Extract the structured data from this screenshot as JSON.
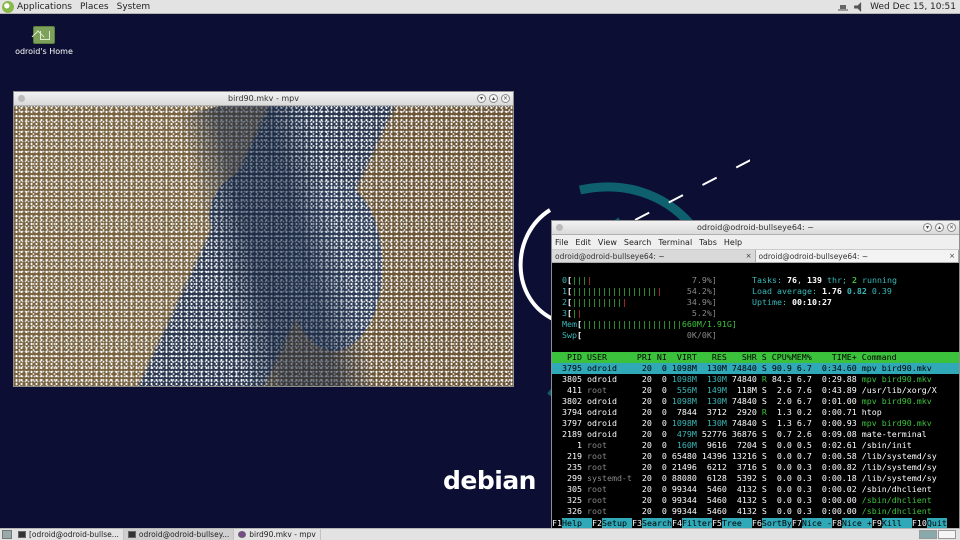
{
  "top_panel": {
    "menus": [
      "Applications",
      "Places",
      "System"
    ],
    "clock": "Wed Dec 15, 10:51"
  },
  "desktop": {
    "home_icon_label": "odroid's Home",
    "wallpaper_text": "debian"
  },
  "mpv_window": {
    "title": "bird90.mkv - mpv"
  },
  "terminal_window": {
    "title": "odroid@odroid-bullseye64: ~",
    "menus": [
      "File",
      "Edit",
      "View",
      "Search",
      "Terminal",
      "Tabs",
      "Help"
    ],
    "tabs": [
      {
        "label": "odroid@odroid-bullseye64: ~",
        "active": false
      },
      {
        "label": "odroid@odroid-bullseye64: ~",
        "active": true
      }
    ]
  },
  "htop": {
    "cpu_meters": [
      {
        "id": "0",
        "bar": "||||",
        "pct": "7.9%]"
      },
      {
        "id": "1",
        "bar": "||||||||||||||||||",
        "pct": "54.2%]"
      },
      {
        "id": "2",
        "bar": "|||||||||||",
        "pct": "34.9%]"
      },
      {
        "id": "3",
        "bar": "||",
        "pct": "5.2%]"
      }
    ],
    "mem": {
      "label": "Mem",
      "bar": "||||||||||||||||||||",
      "value": "660M/1.91G]"
    },
    "swp": {
      "label": "Swp",
      "value": "0K/0K]"
    },
    "tasks": {
      "label": "Tasks:",
      "tasks": "76",
      "thr_count": "139",
      "thr_label": "thr;",
      "running": "2",
      "running_label": "running"
    },
    "load": {
      "label": "Load average:",
      "v1": "1.76",
      "v2": "0.82",
      "v3": "0.39"
    },
    "uptime": {
      "label": "Uptime:",
      "value": "00:10:27"
    },
    "columns": [
      "PID",
      "USER",
      "PRI",
      "NI",
      "VIRT",
      "RES",
      "SHR",
      "S",
      "CPU%",
      "MEM%",
      "TIME+",
      "Command"
    ],
    "processes": [
      {
        "pid": "3795",
        "user": "odroid",
        "pri": "20",
        "ni": "0",
        "virt": "1098M",
        "res": "130M",
        "shr": "74840",
        "s": "S",
        "cpu": "90.9",
        "mem": "6.7",
        "time": "0:34.60",
        "cmd": "mpv bird90.mkv",
        "selected": true
      },
      {
        "pid": "3805",
        "user": "odroid",
        "pri": "20",
        "ni": "0",
        "virt": "1098M",
        "res": "130M",
        "shr": "74840",
        "s": "R",
        "cpu": "84.3",
        "mem": "6.7",
        "time": "0:29.88",
        "cmd": "mpv bird90.mkv"
      },
      {
        "pid": "411",
        "user": "root",
        "pri": "20",
        "ni": "0",
        "virt": "556M",
        "res": "149M",
        "shr": "118M",
        "s": "S",
        "cpu": "2.6",
        "mem": "7.6",
        "time": "0:43.89",
        "cmd": "/usr/lib/xorg/X"
      },
      {
        "pid": "3802",
        "user": "odroid",
        "pri": "20",
        "ni": "0",
        "virt": "1098M",
        "res": "130M",
        "shr": "74840",
        "s": "S",
        "cpu": "2.0",
        "mem": "6.7",
        "time": "0:01.00",
        "cmd": "mpv bird90.mkv"
      },
      {
        "pid": "3794",
        "user": "odroid",
        "pri": "20",
        "ni": "0",
        "virt": "7844",
        "res": "3712",
        "shr": "2920",
        "s": "R",
        "cpu": "1.3",
        "mem": "0.2",
        "time": "0:00.71",
        "cmd": "htop"
      },
      {
        "pid": "3797",
        "user": "odroid",
        "pri": "20",
        "ni": "0",
        "virt": "1098M",
        "res": "130M",
        "shr": "74840",
        "s": "S",
        "cpu": "1.3",
        "mem": "6.7",
        "time": "0:00.93",
        "cmd": "mpv bird90.mkv"
      },
      {
        "pid": "2189",
        "user": "odroid",
        "pri": "20",
        "ni": "0",
        "virt": "479M",
        "res": "52776",
        "shr": "36876",
        "s": "S",
        "cpu": "0.7",
        "mem": "2.6",
        "time": "0:09.08",
        "cmd": "mate-terminal"
      },
      {
        "pid": "1",
        "user": "root",
        "pri": "20",
        "ni": "0",
        "virt": "160M",
        "res": "9616",
        "shr": "7204",
        "s": "S",
        "cpu": "0.0",
        "mem": "0.5",
        "time": "0:02.61",
        "cmd": "/sbin/init"
      },
      {
        "pid": "219",
        "user": "root",
        "pri": "20",
        "ni": "0",
        "virt": "65480",
        "res": "14396",
        "shr": "13216",
        "s": "S",
        "cpu": "0.0",
        "mem": "0.7",
        "time": "0:00.58",
        "cmd": "/lib/systemd/sy"
      },
      {
        "pid": "235",
        "user": "root",
        "pri": "20",
        "ni": "0",
        "virt": "21496",
        "res": "6212",
        "shr": "3716",
        "s": "S",
        "cpu": "0.0",
        "mem": "0.3",
        "time": "0:00.82",
        "cmd": "/lib/systemd/sy"
      },
      {
        "pid": "299",
        "user": "systemd-t",
        "pri": "20",
        "ni": "0",
        "virt": "88080",
        "res": "6128",
        "shr": "5392",
        "s": "S",
        "cpu": "0.0",
        "mem": "0.3",
        "time": "0:00.18",
        "cmd": "/lib/systemd/sy"
      },
      {
        "pid": "305",
        "user": "root",
        "pri": "20",
        "ni": "0",
        "virt": "99344",
        "res": "5460",
        "shr": "4132",
        "s": "S",
        "cpu": "0.0",
        "mem": "0.3",
        "time": "0:00.02",
        "cmd": "/sbin/dhclient"
      },
      {
        "pid": "325",
        "user": "root",
        "pri": "20",
        "ni": "0",
        "virt": "99344",
        "res": "5460",
        "shr": "4132",
        "s": "S",
        "cpu": "0.0",
        "mem": "0.3",
        "time": "0:00.00",
        "cmd": "/sbin/dhclient"
      },
      {
        "pid": "326",
        "user": "root",
        "pri": "20",
        "ni": "0",
        "virt": "99344",
        "res": "5460",
        "shr": "4132",
        "s": "S",
        "cpu": "0.0",
        "mem": "0.3",
        "time": "0:00.00",
        "cmd": "/sbin/dhclient"
      }
    ],
    "fkeys": [
      {
        "key": "F1",
        "label": "Help  "
      },
      {
        "key": "F2",
        "label": "Setup "
      },
      {
        "key": "F3",
        "label": "Search"
      },
      {
        "key": "F4",
        "label": "Filter"
      },
      {
        "key": "F5",
        "label": "Tree  "
      },
      {
        "key": "F6",
        "label": "SortBy"
      },
      {
        "key": "F7",
        "label": "Nice -"
      },
      {
        "key": "F8",
        "label": "Nice +"
      },
      {
        "key": "F9",
        "label": "Kill  "
      },
      {
        "key": "F10",
        "label": "Quit"
      }
    ]
  },
  "taskbar": {
    "items": [
      {
        "label": "[odroid@odroid-bullse...",
        "icon": "terminal-icon",
        "active": false
      },
      {
        "label": "odroid@odroid-bullsey...",
        "icon": "terminal-icon",
        "active": true
      },
      {
        "label": "bird90.mkv - mpv",
        "icon": "mpv-icon",
        "active": false
      }
    ]
  },
  "colors": {
    "desktop_bg": "#0c0f33",
    "htop_green": "#3cc13c",
    "htop_cyan": "#2fa8b8"
  }
}
